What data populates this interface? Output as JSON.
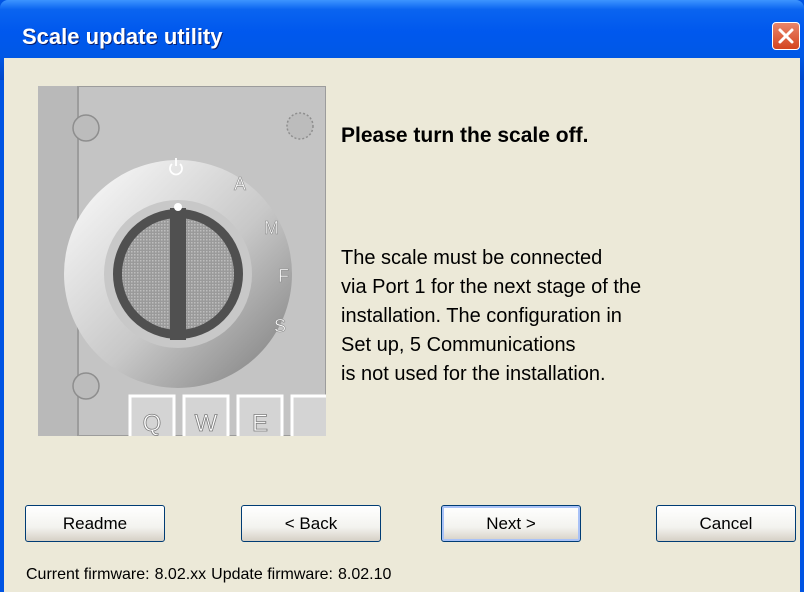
{
  "window": {
    "title": "Scale update utility"
  },
  "illustration": {
    "dial_labels": [
      "A",
      "M",
      "F",
      "S"
    ],
    "keys": [
      "Q",
      "W",
      "E"
    ]
  },
  "content": {
    "heading": "Please turn the scale off.",
    "paragraph_lines": [
      "The scale must be connected",
      "via Port 1 for the next stage of the",
      "installation. The configuration in",
      "Set up, 5 Communications",
      "is not used for the installation."
    ]
  },
  "buttons": {
    "readme": "Readme",
    "back": "< Back",
    "next": "Next >",
    "cancel": "Cancel"
  },
  "status": {
    "current_label": "Current firmware:",
    "current_value": "8.02.xx",
    "update_label": "Update firmware:",
    "update_value": "8.02.10"
  },
  "colors": {
    "titlebar": "#0058e6",
    "close_button": "#d4441e",
    "dialog_background": "#ece9d8"
  }
}
